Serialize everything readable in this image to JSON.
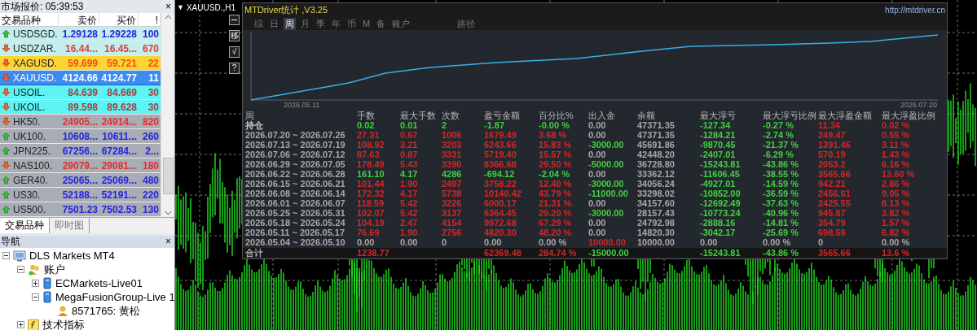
{
  "market_watch": {
    "title": "市场报价: 05:39:53",
    "close": "×",
    "columns": [
      "交易品种",
      "卖价",
      "买价",
      "!"
    ],
    "rows": [
      {
        "symbol": "USDSGD.",
        "rising": true,
        "color": "#c2eeee",
        "selected": false,
        "quotes": [
          {
            "text": "1.29128",
            "color": "#2424e0"
          },
          {
            "text": "1.29228",
            "color": "#2424e0"
          },
          {
            "text": "100",
            "color": "#2424e0"
          }
        ]
      },
      {
        "symbol": "USDZAR.",
        "rising": false,
        "color": "#c2eeee",
        "selected": false,
        "quotes": [
          {
            "text": "16.44...",
            "color": "#e03c3c"
          },
          {
            "text": "16.45...",
            "color": "#e03c3c"
          },
          {
            "text": "670",
            "color": "#e03c3c"
          }
        ]
      },
      {
        "symbol": "XAGUSD.",
        "rising": false,
        "color": "#fcd434",
        "selected": false,
        "quotes": [
          {
            "text": "59.699",
            "color": "#f05010"
          },
          {
            "text": "59.721",
            "color": "#f05010"
          },
          {
            "text": "22",
            "color": "#f05010"
          }
        ]
      },
      {
        "symbol": "XAUUSD.",
        "rising": false,
        "color": "#3c8cf0",
        "selected": true,
        "quotes": [
          {
            "text": "4124.66",
            "color": "#ffffff"
          },
          {
            "text": "4124.77",
            "color": "#ffffff"
          },
          {
            "text": "11",
            "color": "#ffffff"
          }
        ]
      },
      {
        "symbol": "USOIL.",
        "rising": false,
        "color": "#5cf4f4",
        "selected": false,
        "quotes": [
          {
            "text": "84.639",
            "color": "#a04040"
          },
          {
            "text": "84.669",
            "color": "#a04040"
          },
          {
            "text": "30",
            "color": "#a04040"
          }
        ]
      },
      {
        "symbol": "UKOIL.",
        "rising": false,
        "color": "#5cf4f4",
        "selected": false,
        "quotes": [
          {
            "text": "89.598",
            "color": "#a04040"
          },
          {
            "text": "89.628",
            "color": "#a04040"
          },
          {
            "text": "30",
            "color": "#a04040"
          }
        ]
      },
      {
        "symbol": "HK50.",
        "rising": false,
        "color": "#a8acb4",
        "selected": false,
        "quotes": [
          {
            "text": "24905...",
            "color": "#e03030"
          },
          {
            "text": "24914...",
            "color": "#e03030"
          },
          {
            "text": "820",
            "color": "#e03030"
          }
        ]
      },
      {
        "symbol": "UK100.",
        "rising": true,
        "color": "#a8acb4",
        "selected": false,
        "quotes": [
          {
            "text": "10608...",
            "color": "#2424e0"
          },
          {
            "text": "10611...",
            "color": "#2424e0"
          },
          {
            "text": "260",
            "color": "#2424e0"
          }
        ]
      },
      {
        "symbol": "JPN225.",
        "rising": true,
        "color": "#a8acb4",
        "selected": false,
        "quotes": [
          {
            "text": "67256...",
            "color": "#2424e0"
          },
          {
            "text": "67284...",
            "color": "#2424e0"
          },
          {
            "text": "2...",
            "color": "#2424e0"
          }
        ]
      },
      {
        "symbol": "NAS100.",
        "rising": false,
        "color": "#a8acb4",
        "selected": false,
        "quotes": [
          {
            "text": "29079...",
            "color": "#e03030"
          },
          {
            "text": "29081...",
            "color": "#e03030"
          },
          {
            "text": "180",
            "color": "#e03030"
          }
        ]
      },
      {
        "symbol": "GER40.",
        "rising": true,
        "color": "#a8acb4",
        "selected": false,
        "quotes": [
          {
            "text": "25065...",
            "color": "#2424e0"
          },
          {
            "text": "25069...",
            "color": "#2424e0"
          },
          {
            "text": "480",
            "color": "#2424e0"
          }
        ]
      },
      {
        "symbol": "US30.",
        "rising": true,
        "color": "#a8acb4",
        "selected": false,
        "quotes": [
          {
            "text": "52188...",
            "color": "#2424e0"
          },
          {
            "text": "52191...",
            "color": "#2424e0"
          },
          {
            "text": "220",
            "color": "#2424e0"
          }
        ]
      },
      {
        "symbol": "US500.",
        "rising": true,
        "color": "#a8acb4",
        "selected": false,
        "quotes": [
          {
            "text": "7501.23",
            "color": "#2424e0"
          },
          {
            "text": "7502.53",
            "color": "#2424e0"
          },
          {
            "text": "130",
            "color": "#2424e0"
          }
        ]
      }
    ],
    "tabs": [
      {
        "label": "交易品种",
        "selected": true
      },
      {
        "label": "即时图",
        "selected": false
      }
    ]
  },
  "navigator": {
    "title": "导航",
    "close": "×",
    "tree": [
      {
        "label": "DLS Markets MT4",
        "kind": "terminal",
        "expanded": true,
        "children": [
          {
            "label": "账户",
            "kind": "accounts",
            "expanded": true,
            "children": [
              {
                "label": "ECMarkets-Live01",
                "kind": "server",
                "expanded": false
              },
              {
                "label": "MegaFusionGroup-Live 1",
                "kind": "server",
                "expanded": true,
                "children": [
                  {
                    "label": "8571765: 黄松",
                    "kind": "user"
                  }
                ]
              }
            ]
          },
          {
            "label": "技术指标",
            "kind": "indicator",
            "expanded": false
          }
        ]
      }
    ]
  },
  "chart": {
    "title": "XAUUSD.,H1",
    "menu_glyph": "▼",
    "tools": [
      "移",
      "√",
      "?"
    ]
  },
  "stats_panel": {
    "title": "MTDriver统计 ,V3.25",
    "url": "http://mtdriver.cn",
    "tabs": [
      {
        "label": "综",
        "selected": false
      },
      {
        "label": "日",
        "selected": false
      },
      {
        "label": "周",
        "selected": true
      },
      {
        "label": "月",
        "selected": false
      },
      {
        "label": "季",
        "selected": false
      },
      {
        "label": "年",
        "selected": false
      },
      {
        "label": "币",
        "selected": false
      },
      {
        "label": "M",
        "selected": false
      },
      {
        "label": "备",
        "selected": false
      },
      {
        "label": "账户",
        "selected": false
      }
    ],
    "path_button": "路径",
    "equity_chart": {
      "start_label": "2026.05.11",
      "end_label": "2026.07.20"
    },
    "columns": [
      "周",
      "手数",
      "最大手数",
      "次数",
      "盈亏金额",
      "百分比%",
      "出入金",
      "余额",
      "最大浮亏",
      "最大浮亏比例",
      "最大浮盈金额",
      "最大浮盈比例"
    ],
    "rows": [
      {
        "kind": "position",
        "cells": [
          {
            "text": "持仓",
            "color": "#c8c8c8"
          },
          {
            "text": "0.02",
            "color": "#40d040"
          },
          {
            "text": "0.01",
            "color": "#40d040"
          },
          {
            "text": "2",
            "color": "#40d040"
          },
          {
            "text": "-1.87",
            "color": "#40d040"
          },
          {
            "text": "-0.00 %",
            "color": "#40d040"
          },
          {
            "text": "0.00",
            "color": "#a8a8a8"
          },
          {
            "text": "47371.35",
            "color": "#a8a8a8"
          },
          {
            "text": "-127.34",
            "color": "#40d040"
          },
          {
            "text": "-0.27 %",
            "color": "#40d040"
          },
          {
            "text": "11.34",
            "color": "#d02828"
          },
          {
            "text": "0.02 %",
            "color": "#d02828"
          }
        ]
      },
      {
        "kind": "week",
        "cells": [
          {
            "text": "2026.07.20 ~ 2026.07.26",
            "color": "#a8a8a8"
          },
          {
            "text": "27.31",
            "color": "#d02828"
          },
          {
            "text": "0.67",
            "color": "#d02828"
          },
          {
            "text": "1006",
            "color": "#d02828"
          },
          {
            "text": "1679.49",
            "color": "#d02828"
          },
          {
            "text": "3.68 %",
            "color": "#d02828"
          },
          {
            "text": "0.00",
            "color": "#a8a8a8"
          },
          {
            "text": "47371.35",
            "color": "#a8a8a8"
          },
          {
            "text": "-1284.21",
            "color": "#40d040"
          },
          {
            "text": "-2.74 %",
            "color": "#40d040"
          },
          {
            "text": "249.47",
            "color": "#d02828"
          },
          {
            "text": "0.55 %",
            "color": "#d02828"
          }
        ]
      },
      {
        "kind": "week",
        "cells": [
          {
            "text": "2026.07.13 ~ 2026.07.19",
            "color": "#a8a8a8"
          },
          {
            "text": "108.92",
            "color": "#d02828"
          },
          {
            "text": "3.21",
            "color": "#d02828"
          },
          {
            "text": "3203",
            "color": "#d02828"
          },
          {
            "text": "6243.66",
            "color": "#d02828"
          },
          {
            "text": "15.83 %",
            "color": "#d02828"
          },
          {
            "text": "-3000.00",
            "color": "#40d040"
          },
          {
            "text": "45691.86",
            "color": "#a8a8a8"
          },
          {
            "text": "-9870.45",
            "color": "#40d040"
          },
          {
            "text": "-21.37 %",
            "color": "#40d040"
          },
          {
            "text": "1391.46",
            "color": "#d02828"
          },
          {
            "text": "3.11 %",
            "color": "#d02828"
          }
        ]
      },
      {
        "kind": "week",
        "cells": [
          {
            "text": "2026.07.06 ~ 2026.07.12",
            "color": "#a8a8a8"
          },
          {
            "text": "87.63",
            "color": "#d02828"
          },
          {
            "text": "0.87",
            "color": "#d02828"
          },
          {
            "text": "3331",
            "color": "#d02828"
          },
          {
            "text": "5719.40",
            "color": "#d02828"
          },
          {
            "text": "15.57 %",
            "color": "#d02828"
          },
          {
            "text": "0.00",
            "color": "#a8a8a8"
          },
          {
            "text": "42448.20",
            "color": "#a8a8a8"
          },
          {
            "text": "-2407.01",
            "color": "#40d040"
          },
          {
            "text": "-6.29 %",
            "color": "#40d040"
          },
          {
            "text": "570.19",
            "color": "#d02828"
          },
          {
            "text": "1.43 %",
            "color": "#d02828"
          }
        ]
      },
      {
        "kind": "week",
        "cells": [
          {
            "text": "2026.06.29 ~ 2026.07.05",
            "color": "#a8a8a8"
          },
          {
            "text": "178.49",
            "color": "#d02828"
          },
          {
            "text": "5.43",
            "color": "#d02828"
          },
          {
            "text": "3390",
            "color": "#d02828"
          },
          {
            "text": "8366.68",
            "color": "#d02828"
          },
          {
            "text": "29.50 %",
            "color": "#d02828"
          },
          {
            "text": "-5000.00",
            "color": "#40d040"
          },
          {
            "text": "36728.80",
            "color": "#a8a8a8"
          },
          {
            "text": "-15243.81",
            "color": "#40d040"
          },
          {
            "text": "-43.86 %",
            "color": "#40d040"
          },
          {
            "text": "2053.2",
            "color": "#d02828"
          },
          {
            "text": "6.16 %",
            "color": "#d02828"
          }
        ]
      },
      {
        "kind": "week",
        "cells": [
          {
            "text": "2026.06.22 ~ 2026.06.28",
            "color": "#a8a8a8"
          },
          {
            "text": "161.10",
            "color": "#40d040"
          },
          {
            "text": "4.17",
            "color": "#40d040"
          },
          {
            "text": "4286",
            "color": "#40d040"
          },
          {
            "text": "-694.12",
            "color": "#40d040"
          },
          {
            "text": "-2.04 %",
            "color": "#40d040"
          },
          {
            "text": "0.00",
            "color": "#a8a8a8"
          },
          {
            "text": "33362.12",
            "color": "#a8a8a8"
          },
          {
            "text": "-11606.45",
            "color": "#40d040"
          },
          {
            "text": "-38.55 %",
            "color": "#40d040"
          },
          {
            "text": "3565.66",
            "color": "#d02828"
          },
          {
            "text": "13.60 %",
            "color": "#d02828"
          }
        ]
      },
      {
        "kind": "week",
        "cells": [
          {
            "text": "2026.06.15 ~ 2026.06.21",
            "color": "#a8a8a8"
          },
          {
            "text": "101.44",
            "color": "#d02828"
          },
          {
            "text": "1.90",
            "color": "#d02828"
          },
          {
            "text": "2497",
            "color": "#d02828"
          },
          {
            "text": "3758.22",
            "color": "#d02828"
          },
          {
            "text": "12.40 %",
            "color": "#d02828"
          },
          {
            "text": "-3000.00",
            "color": "#40d040"
          },
          {
            "text": "34056.24",
            "color": "#a8a8a8"
          },
          {
            "text": "-4927.01",
            "color": "#40d040"
          },
          {
            "text": "-14.59 %",
            "color": "#40d040"
          },
          {
            "text": "942.21",
            "color": "#d02828"
          },
          {
            "text": "2.86 %",
            "color": "#d02828"
          }
        ]
      },
      {
        "kind": "week",
        "cells": [
          {
            "text": "2026.06.08 ~ 2026.06.14",
            "color": "#a8a8a8"
          },
          {
            "text": "172.32",
            "color": "#d02828"
          },
          {
            "text": "4.17",
            "color": "#d02828"
          },
          {
            "text": "5738",
            "color": "#d02828"
          },
          {
            "text": "10140.42",
            "color": "#d02828"
          },
          {
            "text": "43.79 %",
            "color": "#d02828"
          },
          {
            "text": "-11000.00",
            "color": "#40d040"
          },
          {
            "text": "33298.02",
            "color": "#a8a8a8"
          },
          {
            "text": "-10852.00",
            "color": "#40d040"
          },
          {
            "text": "-36.59 %",
            "color": "#40d040"
          },
          {
            "text": "2456.61",
            "color": "#d02828"
          },
          {
            "text": "9.05 %",
            "color": "#d02828"
          }
        ]
      },
      {
        "kind": "week",
        "cells": [
          {
            "text": "2026.06.01 ~ 2026.06.07",
            "color": "#a8a8a8"
          },
          {
            "text": "118.59",
            "color": "#d02828"
          },
          {
            "text": "5.42",
            "color": "#d02828"
          },
          {
            "text": "3226",
            "color": "#d02828"
          },
          {
            "text": "6000.17",
            "color": "#d02828"
          },
          {
            "text": "21.31 %",
            "color": "#d02828"
          },
          {
            "text": "0.00",
            "color": "#a8a8a8"
          },
          {
            "text": "34157.60",
            "color": "#a8a8a8"
          },
          {
            "text": "-12692.49",
            "color": "#40d040"
          },
          {
            "text": "-37.63 %",
            "color": "#40d040"
          },
          {
            "text": "2425.55",
            "color": "#d02828"
          },
          {
            "text": "8.13 %",
            "color": "#d02828"
          }
        ]
      },
      {
        "kind": "week",
        "cells": [
          {
            "text": "2026.05.25 ~ 2026.05.31",
            "color": "#a8a8a8"
          },
          {
            "text": "102.07",
            "color": "#d02828"
          },
          {
            "text": "5.42",
            "color": "#d02828"
          },
          {
            "text": "3137",
            "color": "#d02828"
          },
          {
            "text": "6364.45",
            "color": "#d02828"
          },
          {
            "text": "29.20 %",
            "color": "#d02828"
          },
          {
            "text": "-3000.00",
            "color": "#40d040"
          },
          {
            "text": "28157.43",
            "color": "#a8a8a8"
          },
          {
            "text": "-10773.24",
            "color": "#40d040"
          },
          {
            "text": "-40.96 %",
            "color": "#40d040"
          },
          {
            "text": "945.87",
            "color": "#d02828"
          },
          {
            "text": "3.82 %",
            "color": "#d02828"
          }
        ]
      },
      {
        "kind": "week",
        "cells": [
          {
            "text": "2026.05.18 ~ 2026.05.24",
            "color": "#a8a8a8"
          },
          {
            "text": "104.19",
            "color": "#d02828"
          },
          {
            "text": "2.47",
            "color": "#d02828"
          },
          {
            "text": "4154",
            "color": "#d02828"
          },
          {
            "text": "9972.68",
            "color": "#d02828"
          },
          {
            "text": "67.29 %",
            "color": "#d02828"
          },
          {
            "text": "0.00",
            "color": "#a8a8a8"
          },
          {
            "text": "24792.98",
            "color": "#a8a8a8"
          },
          {
            "text": "-2888.16",
            "color": "#40d040"
          },
          {
            "text": "-14.81 %",
            "color": "#40d040"
          },
          {
            "text": "354.79",
            "color": "#d02828"
          },
          {
            "text": "1.57 %",
            "color": "#d02828"
          }
        ]
      },
      {
        "kind": "week",
        "cells": [
          {
            "text": "2026.05.11 ~ 2026.05.17",
            "color": "#a8a8a8"
          },
          {
            "text": "76.69",
            "color": "#d02828"
          },
          {
            "text": "1.90",
            "color": "#d02828"
          },
          {
            "text": "2756",
            "color": "#d02828"
          },
          {
            "text": "4820.30",
            "color": "#d02828"
          },
          {
            "text": "48.20 %",
            "color": "#d02828"
          },
          {
            "text": "0.00",
            "color": "#a8a8a8"
          },
          {
            "text": "14820.30",
            "color": "#a8a8a8"
          },
          {
            "text": "-3042.17",
            "color": "#40d040"
          },
          {
            "text": "-25.69 %",
            "color": "#40d040"
          },
          {
            "text": "698.59",
            "color": "#d02828"
          },
          {
            "text": "6.82 %",
            "color": "#d02828"
          }
        ]
      },
      {
        "kind": "week",
        "cells": [
          {
            "text": "2026.05.04 ~ 2026.05.10",
            "color": "#a8a8a8"
          },
          {
            "text": "0.00",
            "color": "#a8a8a8"
          },
          {
            "text": "0.00",
            "color": "#a8a8a8"
          },
          {
            "text": "0",
            "color": "#a8a8a8"
          },
          {
            "text": "0.00",
            "color": "#a8a8a8"
          },
          {
            "text": "0.00 %",
            "color": "#a8a8a8"
          },
          {
            "text": "10000.00",
            "color": "#d02828"
          },
          {
            "text": "10000.00",
            "color": "#a8a8a8"
          },
          {
            "text": "0.00",
            "color": "#a8a8a8"
          },
          {
            "text": "0.00 %",
            "color": "#a8a8a8"
          },
          {
            "text": "0",
            "color": "#a8a8a8"
          },
          {
            "text": "0.00 %",
            "color": "#a8a8a8"
          }
        ]
      },
      {
        "kind": "total",
        "cells": [
          {
            "text": "合计",
            "color": "#a8a8a8"
          },
          {
            "text": "1238.77",
            "color": "#d02828"
          },
          null,
          null,
          {
            "text": "62369.48",
            "color": "#d02828"
          },
          {
            "text": "284.74 %",
            "color": "#d02828"
          },
          {
            "text": "-15000.00",
            "color": "#40d040"
          },
          null,
          {
            "text": "-15243.81",
            "color": "#40d040"
          },
          {
            "text": "-43.86 %",
            "color": "#40d040"
          },
          {
            "text": "3565.66",
            "color": "#d02828"
          },
          {
            "text": "13.6 %",
            "color": "#d02828"
          }
        ]
      }
    ]
  }
}
